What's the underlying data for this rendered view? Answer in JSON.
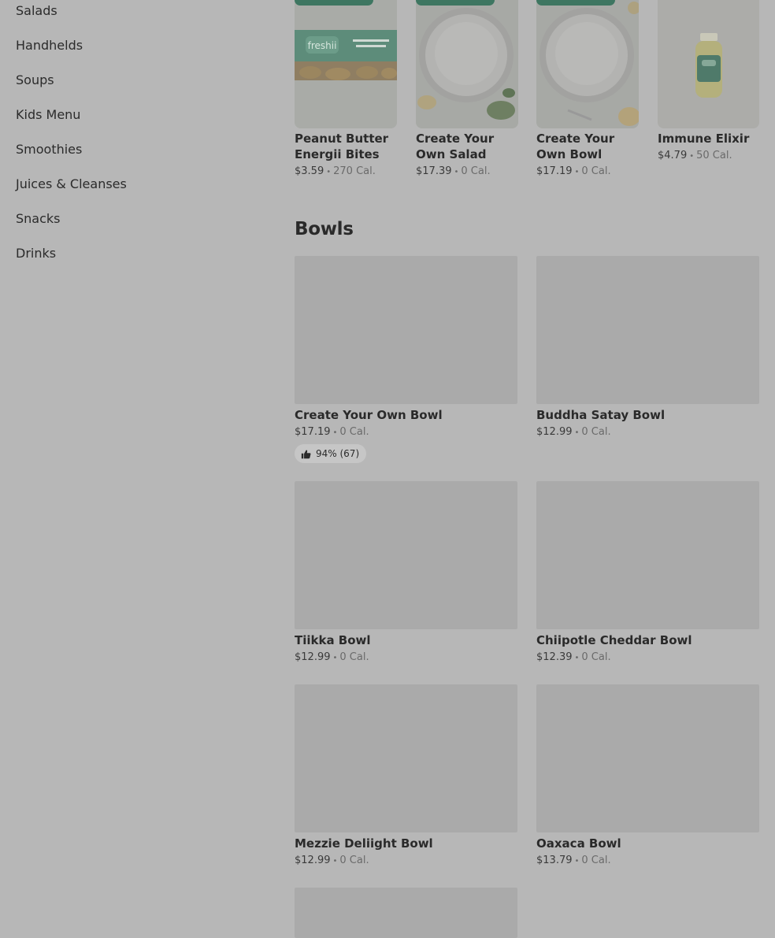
{
  "sidebar": {
    "items": [
      {
        "label": "Salads"
      },
      {
        "label": "Handhelds"
      },
      {
        "label": "Soups"
      },
      {
        "label": "Kids Menu"
      },
      {
        "label": "Smoothies"
      },
      {
        "label": "Juices & Cleanses"
      },
      {
        "label": "Snacks"
      },
      {
        "label": "Drinks"
      }
    ]
  },
  "featured": [
    {
      "name": "Peanut Butter Energii Bites",
      "price": "$3.59",
      "calories": "270 Cal.",
      "logo": "freshii"
    },
    {
      "name": "Create Your Own Salad",
      "price": "$17.39",
      "calories": "0 Cal."
    },
    {
      "name": "Create Your Own Bowl",
      "price": "$17.19",
      "calories": "0 Cal."
    },
    {
      "name": "Immune Elixir",
      "price": "$4.79",
      "calories": "50 Cal."
    }
  ],
  "separator": "•",
  "bowls": {
    "title": "Bowls",
    "items": [
      {
        "name": "Create Your Own Bowl",
        "price": "$17.19",
        "calories": "0 Cal.",
        "rating": "94% (67)"
      },
      {
        "name": "Buddha Satay Bowl",
        "price": "$12.99",
        "calories": "0 Cal."
      },
      {
        "name": "Tiikka Bowl",
        "price": "$12.99",
        "calories": "0 Cal."
      },
      {
        "name": "Chiipotle Cheddar Bowl",
        "price": "$12.39",
        "calories": "0 Cal."
      },
      {
        "name": "Mezzie Deliight Bowl",
        "price": "$12.99",
        "calories": "0 Cal."
      },
      {
        "name": "Oaxaca Bowl",
        "price": "$13.79",
        "calories": "0 Cal."
      }
    ]
  },
  "colors": {
    "overlay_bg": "#b7b7b7",
    "badge_green": "#3e7661"
  },
  "icons": {
    "rating": "thumbs-up-icon"
  }
}
